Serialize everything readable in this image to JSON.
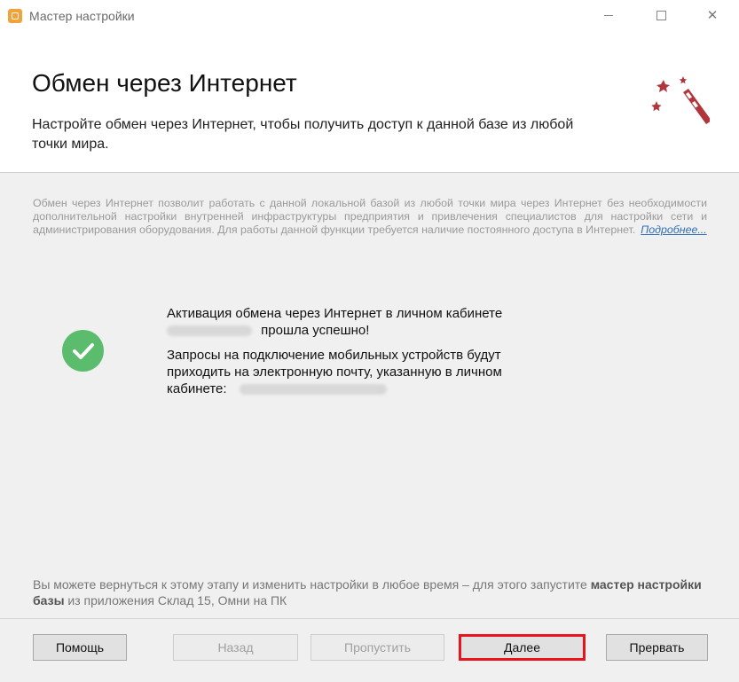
{
  "window": {
    "title": "Мастер настройки"
  },
  "header": {
    "title": "Обмен через Интернет",
    "subtitle": "Настройте обмен через Интернет, чтобы получить доступ к данной базе из любой точки мира."
  },
  "info": {
    "text": "Обмен через Интернет позволит работать с данной локальной базой из любой точки мира через Интернет без необходимости дополнительной настройки внутренней инфраструктуры предприятия и привлечения специалистов для настройки сети и администрирования оборудования. Для работы данной функции требуется наличие постоянного доступа в Интернет.",
    "more_link": "Подробнее..."
  },
  "status": {
    "line1": "Активация обмена через Интернет в личном кабинете",
    "line1_end": "прошла успешно!",
    "line2": "Запросы на подключение мобильных устройств будут приходить на электронную почту, указанную в личном кабинете:"
  },
  "footer": {
    "note_start": "Вы можете вернуться к этому этапу и изменить настройки в любое время – для этого запустите",
    "note_bold": "мастер настройки базы",
    "note_end": "из приложения Склад 15, Омни на ПК"
  },
  "buttons": {
    "help": "Помощь",
    "back": "Назад",
    "skip": "Пропустить",
    "next": "Далее",
    "abort": "Прервать"
  },
  "colors": {
    "accent_check": "#5cbc6e",
    "highlight": "#e8141e",
    "link": "#2f6fb5",
    "wand": "#b0363c"
  }
}
